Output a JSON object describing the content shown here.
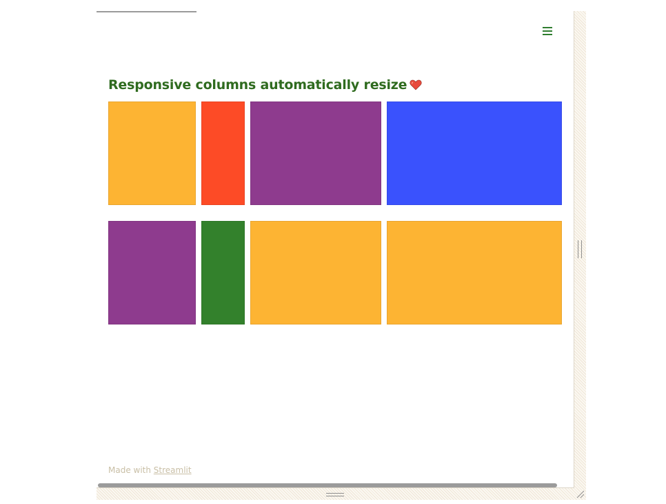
{
  "app": {
    "title": "Responsive columns automatically resize",
    "title_icon": "heart-icon"
  },
  "menu": {
    "icon": "hamburger-menu-icon"
  },
  "colors": {
    "title": "#2f6b1f",
    "orange": "#fdb433",
    "red": "#fd4b26",
    "purple": "#8e3b8e",
    "blue": "#3a52fd",
    "green": "#33812c"
  },
  "rows": [
    {
      "blocks": [
        "#fdb433",
        "#fd4b26",
        "#8e3b8e",
        "#3a52fd"
      ]
    },
    {
      "blocks": [
        "#8e3b8e",
        "#33812c",
        "#fdb433",
        "#fdb433"
      ]
    }
  ],
  "footer": {
    "prefix": "Made with ",
    "link": "Streamlit"
  }
}
